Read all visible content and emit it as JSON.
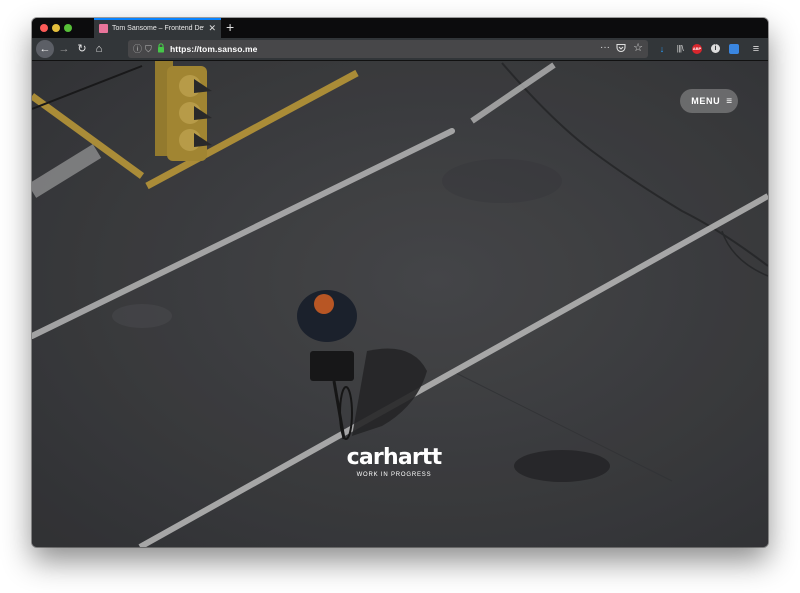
{
  "browser": {
    "tab": {
      "title": "Tom Sansome – Frontend Developer",
      "close": "✕"
    },
    "new_tab": "+",
    "nav": {
      "back": "←",
      "forward": "→",
      "reload": "↻",
      "home": "⌂"
    },
    "url": "https://tom.sanso.me",
    "url_icons": {
      "info": "ⓘ",
      "shield": "⛉",
      "lock": "lock-icon"
    },
    "url_actions": {
      "more": "···",
      "pocket": "pocket-icon",
      "star": "☆"
    },
    "toolbar": {
      "download": "↓",
      "library": "|||\\",
      "abp": "ABP",
      "info": "i",
      "extension": "extension-icon",
      "menu": "≡"
    }
  },
  "page": {
    "menu_button": {
      "label": "MENU",
      "icon": "≡"
    },
    "brand": {
      "name": "carhartt",
      "tagline": "WORK IN PROGRESS"
    }
  },
  "colors": {
    "accent": "#0a84ff",
    "tab_favicon": "#e9749a",
    "download": "#2aa1ff",
    "abp": "#d8262d"
  }
}
